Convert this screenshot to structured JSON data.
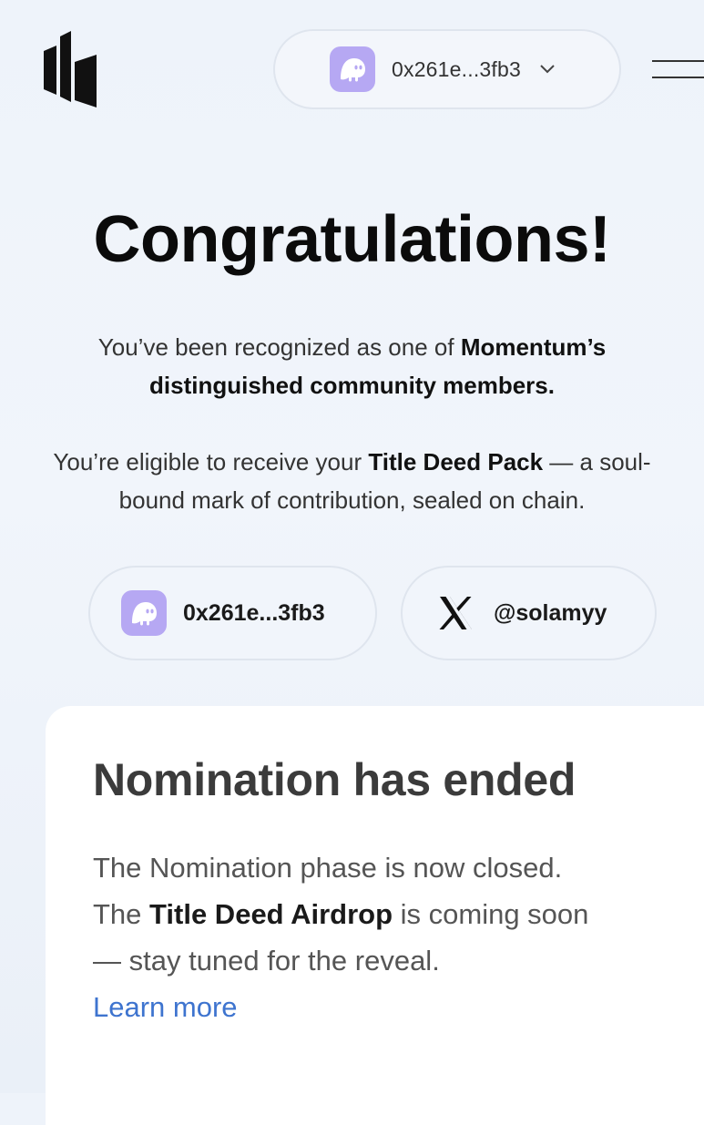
{
  "header": {
    "logo_icon": "momentum-logo-icon",
    "wallet_avatar_icon": "ghost-icon",
    "wallet_address": "0x261e...3fb3",
    "dropdown_icon": "chevron-down-icon",
    "menu_icon": "hamburger-menu-icon"
  },
  "hero": {
    "title": "Congratulations!",
    "para1": {
      "prefix": "You’ve been recognized as one of ",
      "bold": "Momentum’s distinguished community members."
    },
    "para2": {
      "prefix": "You’re eligible to receive your ",
      "bold": "Title Deed Pack",
      "suffix": " — a soul-bound mark of contribution, sealed on chain."
    }
  },
  "accounts": {
    "wallet": {
      "icon": "ghost-icon",
      "label": "0x261e...3fb3"
    },
    "x": {
      "icon": "x-logo-icon",
      "label": "@solamyy"
    }
  },
  "card": {
    "title": "Nomination has ended",
    "line1": "The Nomination phase is now closed.",
    "line2_prefix": "The ",
    "line2_bold": "Title Deed Airdrop",
    "line2_suffix": " is coming soon",
    "line3": "— stay tuned for the reveal.",
    "link": "Learn more"
  },
  "colors": {
    "accent_link": "#3e74cf",
    "avatar_bg": "#b6a8f3",
    "background": "#eef3fa"
  }
}
